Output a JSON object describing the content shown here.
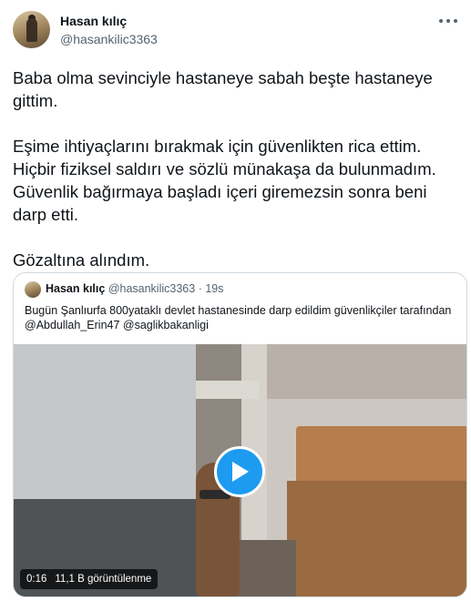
{
  "tweet": {
    "author_name": "Hasan kılıç",
    "author_handle": "@hasankilic3363",
    "more_icon": "more-dots-icon",
    "paragraphs": [
      "Baba olma sevinciyle hastaneye sabah beşte hastaneye gittim.",
      "Eşime ihtiyaçlarını bırakmak için güvenlikten rica ettim. Hiçbir fiziksel saldırı ve sözlü münakaşa da bulunmadım. Güvenlik bağırmaya başladı içeri giremezsin sonra beni darp etti.",
      "Gözaltına alındım."
    ]
  },
  "quoted": {
    "author_name": "Hasan kılıç",
    "author_handle": "@hasankilic3363",
    "separator": "·",
    "time": "19s",
    "text": "Bugün Şanlıurfa 800yataklı devlet hastanesinde darp edildim güvenlikçiler tarafından @Abdullah_Erin47 @saglikbakanligi",
    "video": {
      "duration": "0:16",
      "views": "11,1 B görüntülenme",
      "play_icon": "play-icon"
    }
  },
  "colors": {
    "text": "#0f1419",
    "secondary": "#536471",
    "accent": "#1d9bf0",
    "border": "#cfd9de"
  }
}
